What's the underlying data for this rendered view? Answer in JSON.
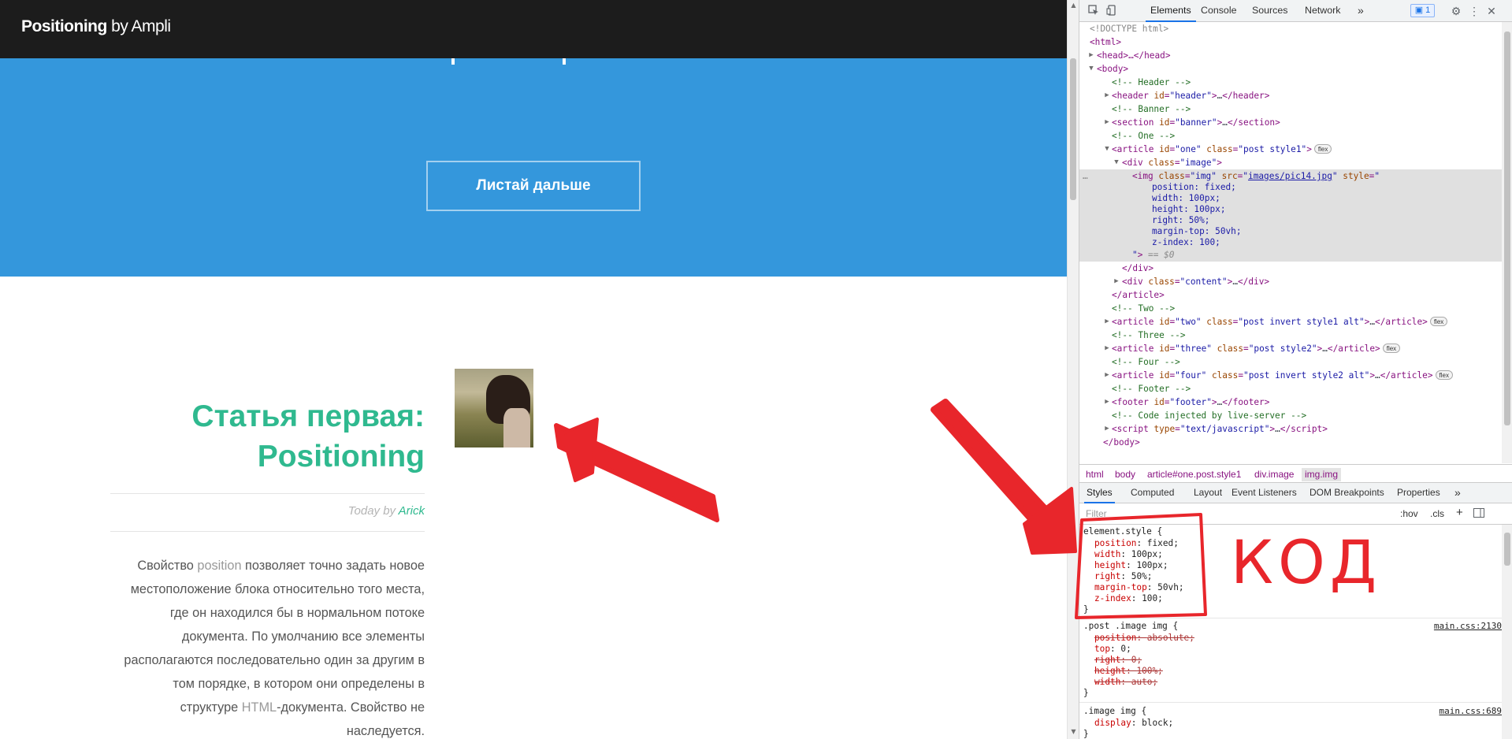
{
  "site": {
    "brand_bold": "Positioning",
    "brand_rest": " by Ampli",
    "banner_button": "Листай дальше",
    "article": {
      "title_line1": "Статья первая:",
      "title_line2": "Positioning",
      "meta_prefix": "Today by ",
      "meta_author": "Arick",
      "p_line1_a": "Свойство ",
      "p_line1_hl": "position",
      "p_line1_b": " позволяет точно задать новое",
      "p_line2": "местоположение блока относительно того места,",
      "p_line3": "где он находился бы в нормальном потоке",
      "p_line4": "документа. По умолчанию все элементы",
      "p_line5": "располагаются последовательно один за другим в",
      "p_line6": "том порядке, в котором они определены в",
      "p_line7_a": "структуре ",
      "p_line7_hl": "HTML",
      "p_line7_b": "-документа. Свойство не",
      "p_line8": "наследуется."
    }
  },
  "devtools": {
    "tabs": [
      "Elements",
      "Console",
      "Sources",
      "Network"
    ],
    "more_tabs": "»",
    "issues_count": "1",
    "dom": {
      "doctype": "<!DOCTYPE html>",
      "html_open": "<html>",
      "head": "<head>…</head>",
      "body_open": "<body>",
      "c_header": "<!-- Header -->",
      "c_banner": "<!-- Banner -->",
      "c_one": "<!-- One -->",
      "c_two": "<!-- Two -->",
      "c_three": "<!-- Three -->",
      "c_four": "<!-- Four -->",
      "c_footer": "<!-- Footer -->",
      "c_injected": "<!-- Code injected by live-server -->",
      "body_close": "</body>",
      "div_close": "</div>",
      "article_close": "</article>",
      "img_src": "images/pic14.jpg",
      "style_lines": [
        "position: fixed;",
        "width: 100px;",
        "height: 100px;",
        "right: 50%;",
        "margin-top: 50vh;",
        "z-index: 100;"
      ],
      "dollar0": "== $0",
      "flex_badge": "flex",
      "ellipsis": "…"
    },
    "breadcrumbs": [
      "html",
      "body",
      "article#one.post.style1",
      "div.image",
      "img.img"
    ],
    "style_tabs": [
      "Styles",
      "Computed",
      "Layout",
      "Event Listeners",
      "DOM Breakpoints",
      "Properties"
    ],
    "filter_placeholder": "Filter",
    "filter_hov": ":hov",
    "filter_cls": ".cls",
    "rules": {
      "element_selector": "element.style {",
      "element_props": [
        {
          "p": "position",
          "v": "fixed;"
        },
        {
          "p": "width",
          "v": "100px;"
        },
        {
          "p": "height",
          "v": "100px;"
        },
        {
          "p": "right",
          "v": "50%;"
        },
        {
          "p": "margin-top",
          "v": "50vh;"
        },
        {
          "p": "z-index",
          "v": "100;"
        }
      ],
      "close": "}",
      "post_selector": ".post .image img {",
      "post_source": "main.css:2130",
      "post_props": [
        {
          "p": "position",
          "v": "absolute;",
          "struck": true
        },
        {
          "p": "top",
          "v": "0;",
          "struck": false
        },
        {
          "p": "right",
          "v": "0;",
          "struck": true
        },
        {
          "p": "height",
          "v": "100%;",
          "struck": true
        },
        {
          "p": "width",
          "v": "auto;",
          "struck": true
        }
      ],
      "image_selector": ".image img {",
      "image_source": "main.css:689",
      "image_props": [
        {
          "p": "display",
          "v": "block;"
        }
      ]
    }
  },
  "annotation": {
    "label": "КОД",
    "color": "#e8262b"
  }
}
